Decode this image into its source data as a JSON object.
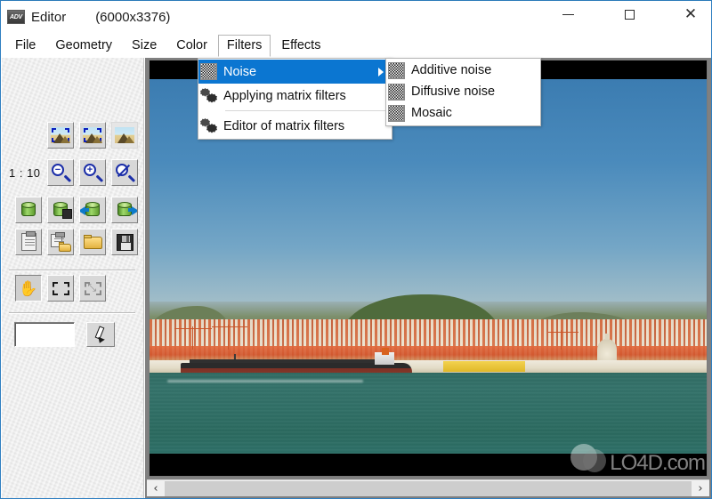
{
  "window": {
    "app_icon_text": "ADV",
    "title": "Editor",
    "dimensions": "(6000x3376)",
    "minimize_label": "–",
    "maximize_label": "□",
    "close_label": "✕"
  },
  "menubar": {
    "items": [
      {
        "label": "File",
        "open": false
      },
      {
        "label": "Geometry",
        "open": false
      },
      {
        "label": "Size",
        "open": false
      },
      {
        "label": "Color",
        "open": false
      },
      {
        "label": "Filters",
        "open": true
      },
      {
        "label": "Effects",
        "open": false
      }
    ]
  },
  "filters_menu": {
    "items": [
      {
        "label": "Noise",
        "icon": "noise-icon",
        "highlighted": true,
        "has_submenu": true
      },
      {
        "label": "Applying matrix filters",
        "icon": "gear-icon",
        "highlighted": false,
        "has_submenu": false
      },
      {
        "label": "Editor of matrix filters",
        "icon": "gear-icon",
        "highlighted": false,
        "has_submenu": false
      }
    ]
  },
  "noise_submenu": {
    "items": [
      {
        "label": "Additive noise",
        "icon": "noise-icon"
      },
      {
        "label": "Diffusive noise",
        "icon": "noise-icon"
      },
      {
        "label": "Mosaic",
        "icon": "noise-icon"
      }
    ]
  },
  "toolbar": {
    "zoom_ratio": "1 : 10",
    "buttons": [
      {
        "name": "select-fit-image-button",
        "icon": "image-crop-icon"
      },
      {
        "name": "select-region-image-button",
        "icon": "image-crop-icon"
      },
      {
        "name": "full-image-button",
        "icon": "image-icon"
      },
      {
        "name": "zoom-out-button",
        "icon": "magnifier-minus-icon"
      },
      {
        "name": "zoom-in-button",
        "icon": "magnifier-plus-icon"
      },
      {
        "name": "zoom-reset-button",
        "icon": "magnifier-none-icon"
      },
      {
        "name": "buffer-button",
        "icon": "barrel-icon"
      },
      {
        "name": "buffer-save-button",
        "icon": "barrel-save-icon"
      },
      {
        "name": "buffer-load-button",
        "icon": "barrel-arrow-left-icon"
      },
      {
        "name": "buffer-store-button",
        "icon": "barrel-arrow-right-icon"
      },
      {
        "name": "paste-button",
        "icon": "clipboard-icon"
      },
      {
        "name": "copy-to-file-button",
        "icon": "clipboard-folder-icon"
      },
      {
        "name": "open-button",
        "icon": "folder-icon"
      },
      {
        "name": "save-button",
        "icon": "floppy-icon"
      },
      {
        "name": "pan-tool-button",
        "icon": "hand-icon"
      },
      {
        "name": "rect-select-tool-button",
        "icon": "dashed-rect-icon"
      },
      {
        "name": "move-select-tool-button",
        "icon": "dashed-rect-move-icon"
      },
      {
        "name": "pencil-tool-button",
        "icon": "pencil-icon"
      }
    ],
    "color_swatch": "#ffffff"
  },
  "scrollbar": {
    "left_arrow": "‹",
    "right_arrow": "›"
  },
  "watermark": {
    "text": "LO4D",
    "suffix": ".com"
  },
  "colors": {
    "accent": "#0b76d1",
    "titlebar_bg": "#ffffff",
    "panel_bg": "#eeeeee",
    "canvas_bg": "#000000",
    "sky": "#3b7cb1",
    "water": "#2f6b62"
  }
}
